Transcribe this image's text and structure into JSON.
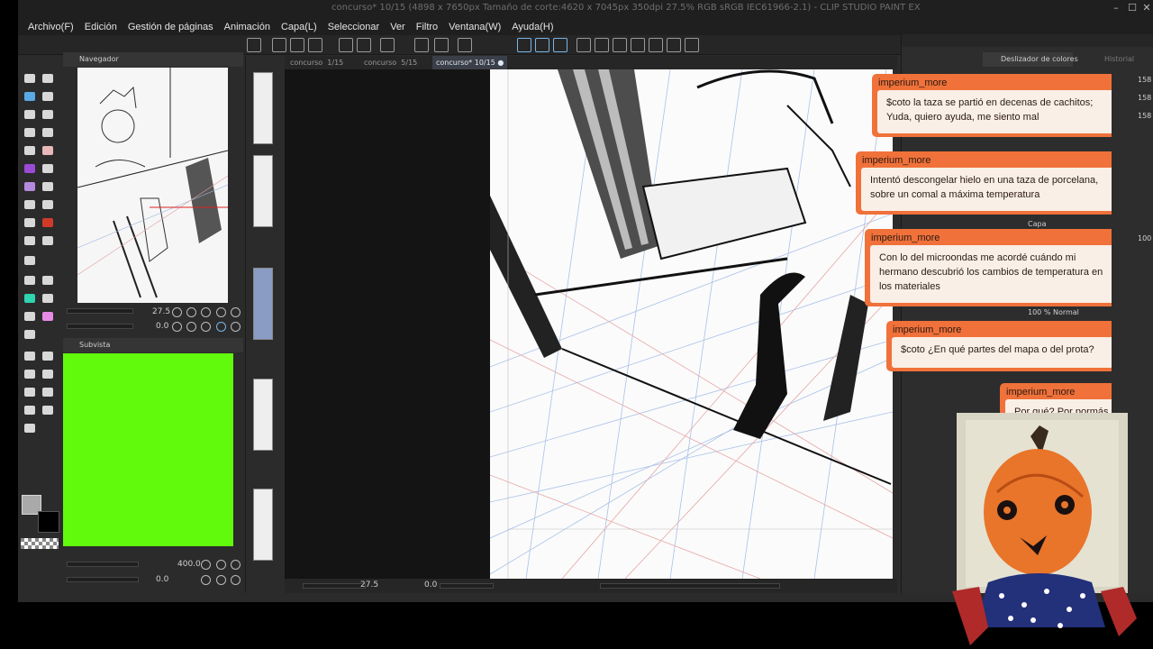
{
  "window": {
    "title": "concurso* 10/15 (4898 x 7650px Tamaño de corte:4620 x 7045px 350dpi 27.5%  RGB sRGB IEC61966-2.1)  - CLIP STUDIO PAINT EX"
  },
  "menu": [
    "Archivo(F)",
    "Edición",
    "Gestión de páginas",
    "Animación",
    "Capa(L)",
    "Seleccionar",
    "Ver",
    "Filtro",
    "Ventana(W)",
    "Ayuda(H)"
  ],
  "panels": {
    "navigator": {
      "title": "Navegador",
      "zoom": "27.5",
      "angle": "0.0"
    },
    "subview": {
      "title": "Subvista",
      "zoom": "400.0",
      "angle": "0.0"
    }
  },
  "document_tabs": [
    {
      "label": "concurso",
      "page": "1/15"
    },
    {
      "label": "concurso",
      "page": "5/15"
    },
    {
      "label": "concurso*",
      "page": "10/15",
      "active": true
    }
  ],
  "canvas_status": {
    "zoom": "27.5",
    "angle": "0.0"
  },
  "right_panel": {
    "tabs": [
      "Deslizador de colores",
      "Historial"
    ],
    "values": [
      "158",
      "158",
      "158"
    ],
    "layer_tab": "Capa",
    "opacity": "100",
    "layer_mode": "100 % Normal"
  },
  "chat": [
    {
      "user": "imperium_more",
      "text": "$coto la taza se partió en decenas de cachitos; Yuda, quiero ayuda, me siento mal"
    },
    {
      "user": "imperium_more",
      "text": "Intentó descongelar hielo en una taza de porcelana, sobre un comal a máxima temperatura"
    },
    {
      "user": "imperium_more",
      "text": "Con lo del microondas me acordé cuándo mi hermano descubrió los cambios de temperatura en los materiales"
    },
    {
      "user": "imperium_more",
      "text": "$coto ¿En qué partes del mapa o del prota?"
    },
    {
      "user": "imperium_more",
      "text": "Por qué? Por pormás"
    }
  ],
  "colors": {
    "subview_green": "#62fa0c",
    "chat_accent": "#f0713a",
    "chat_bubble": "#f9efe6"
  }
}
